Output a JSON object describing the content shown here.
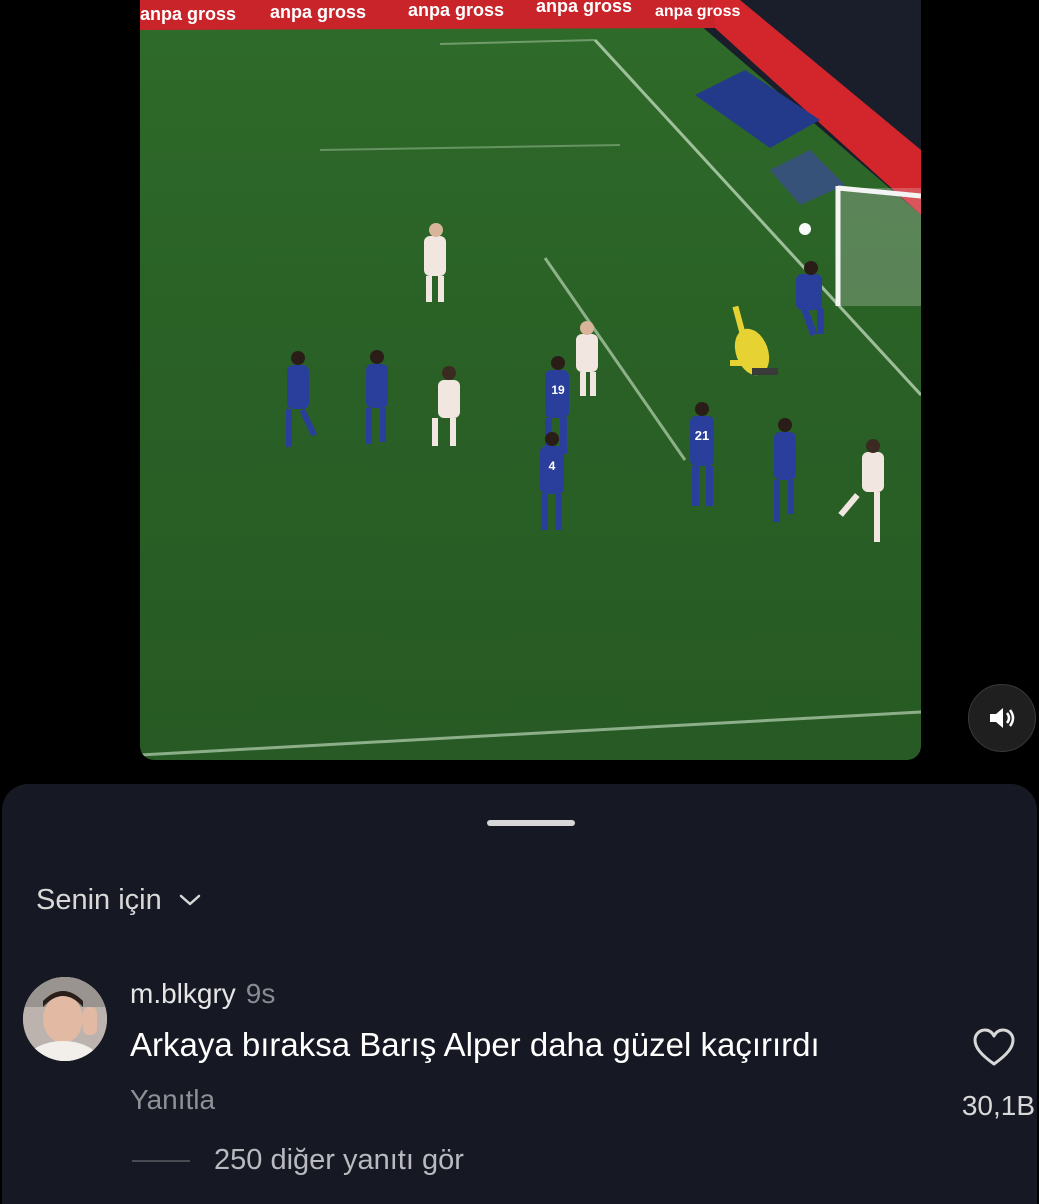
{
  "video": {
    "ad_boards": [
      "anpa gross",
      "anpa gross",
      "anpa gross",
      "anpa gross",
      "anpa gross"
    ],
    "shirt_numbers": [
      "19",
      "4",
      "21"
    ],
    "pitch_color": "#2c6427",
    "home_kit_color": "#f1e6e0",
    "away_kit_color": "#2a3f9b",
    "keeper_kit_color": "#e7d234",
    "mute_icon": "speaker-muted-icon"
  },
  "comments": {
    "filter_label": "Senin için",
    "filter_icon": "chevron-down-icon",
    "items": [
      {
        "username": "m.blkgry",
        "time": "9s",
        "text": "Arkaya bıraksa Barış Alper daha güzel kaçırırdı",
        "reply_label": "Yanıtla",
        "like_count": "30,1B",
        "like_icon": "heart-outline-icon"
      }
    ],
    "more_replies": "250 diğer yanıtı gör"
  }
}
